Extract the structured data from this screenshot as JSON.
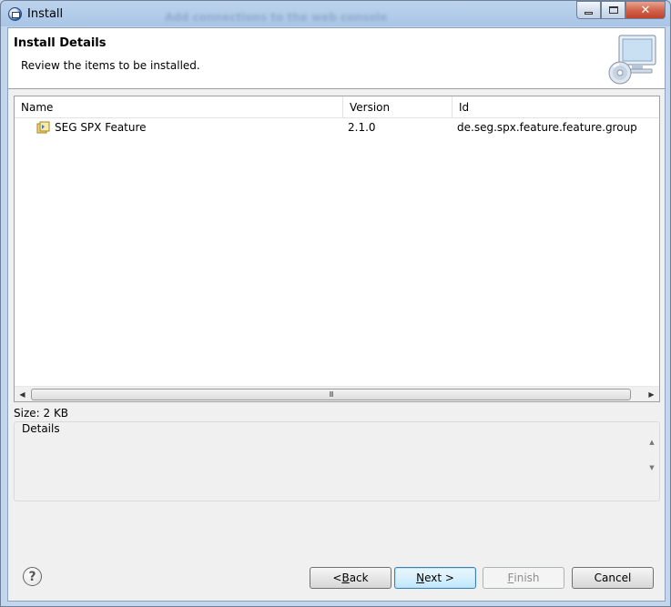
{
  "window": {
    "title": "Install",
    "background_text": "Add connections to the web console"
  },
  "header": {
    "title": "Install Details",
    "description": "Review the items to be installed."
  },
  "table": {
    "columns": {
      "name": "Name",
      "version": "Version",
      "id": "Id"
    },
    "rows": [
      {
        "name": "SEG SPX Feature",
        "version": "2.1.0",
        "id": "de.seg.spx.feature.feature.group"
      }
    ],
    "scroll_thumb_glyph": "III"
  },
  "size_label": "Size: 2 KB",
  "details": {
    "label": "Details"
  },
  "buttons": {
    "back_prefix": "< ",
    "back_mnemonic": "B",
    "back_rest": "ack",
    "next_mnemonic": "N",
    "next_rest": "ext >",
    "finish_mnemonic": "F",
    "finish_rest": "inish",
    "cancel": "Cancel"
  },
  "icons": {
    "help": "?",
    "minimize": "▭",
    "maximize": "□",
    "close": "✕"
  }
}
